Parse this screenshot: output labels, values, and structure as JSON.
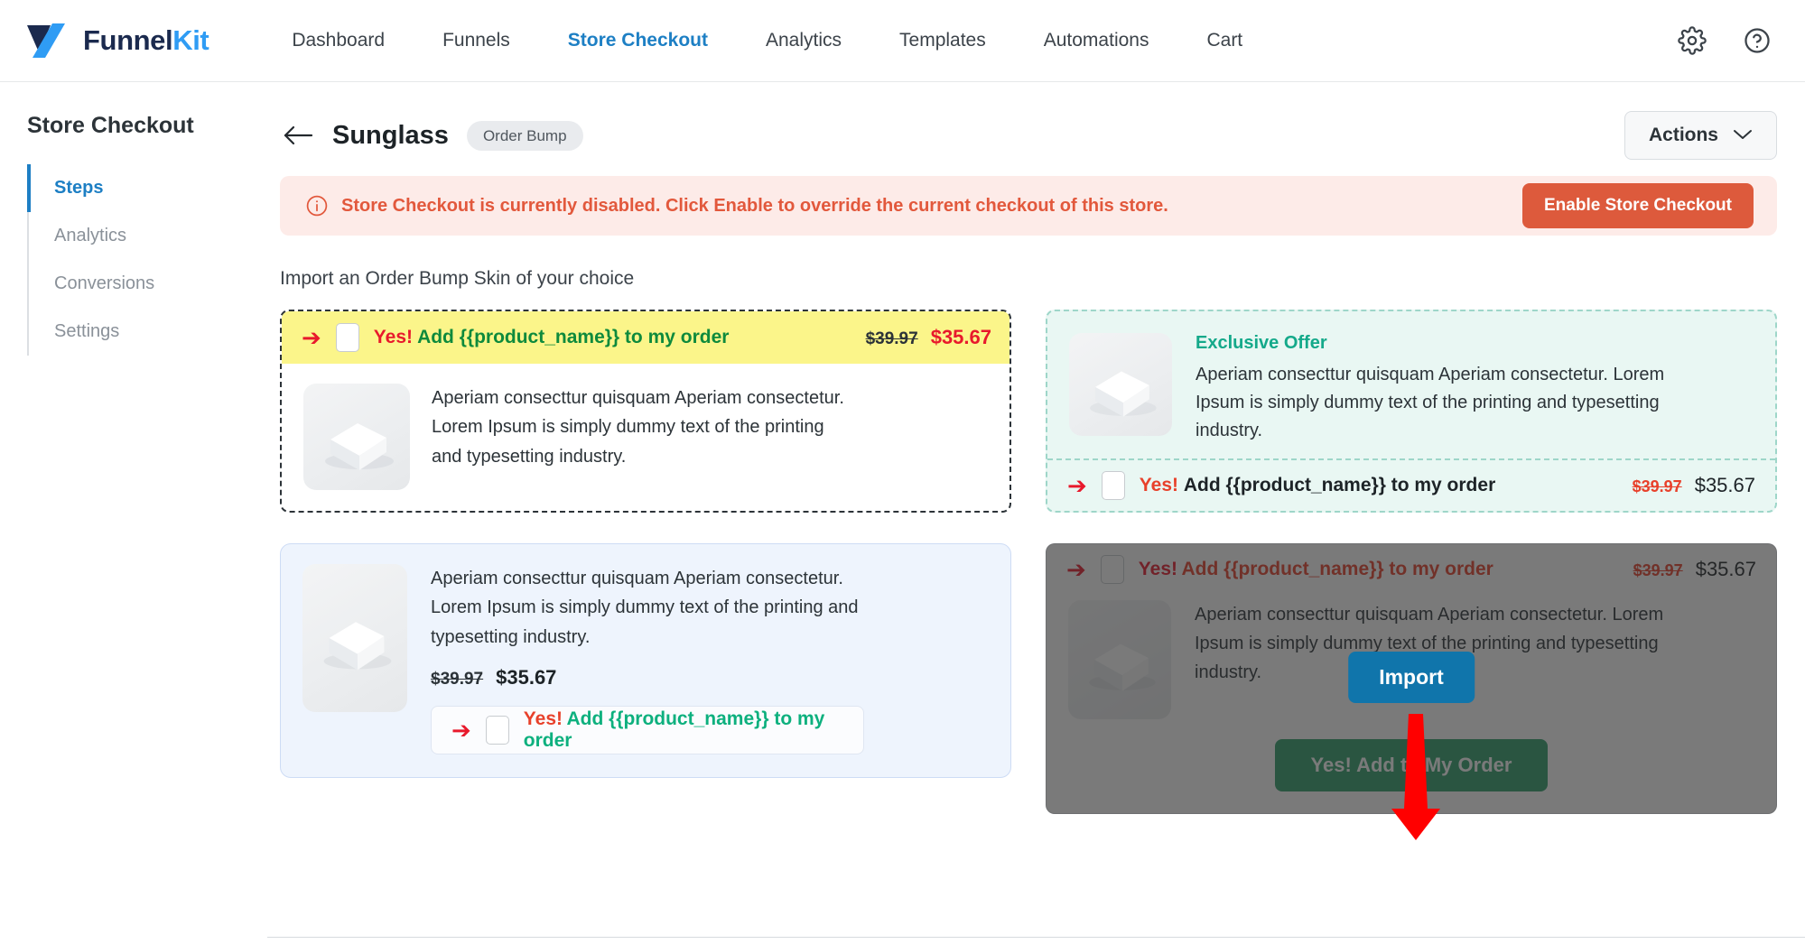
{
  "topnav": {
    "logo": {
      "part1": "Funnel",
      "part2": "Kit",
      "icon": "funnelkit-logo-icon"
    },
    "items": [
      {
        "label": "Dashboard",
        "active": false
      },
      {
        "label": "Funnels",
        "active": false
      },
      {
        "label": "Store Checkout",
        "active": true
      },
      {
        "label": "Analytics",
        "active": false
      },
      {
        "label": "Templates",
        "active": false
      },
      {
        "label": "Automations",
        "active": false
      },
      {
        "label": "Cart",
        "active": false
      }
    ],
    "settings_icon": "gear-icon",
    "help_icon": "help-circle-icon"
  },
  "sidebar": {
    "title": "Store Checkout",
    "items": [
      {
        "label": "Steps",
        "active": true
      },
      {
        "label": "Analytics",
        "active": false
      },
      {
        "label": "Conversions",
        "active": false
      },
      {
        "label": "Settings",
        "active": false
      }
    ]
  },
  "page": {
    "back_icon": "back-arrow-icon",
    "title": "Sunglass",
    "badge": "Order Bump",
    "actions_label": "Actions",
    "actions_chevron": "chevron-down-icon"
  },
  "alert": {
    "icon": "info-circle-icon",
    "message": "Store Checkout is currently disabled. Click Enable to override the current checkout of this store.",
    "button_label": "Enable Store Checkout",
    "bg_color": "#fdebe8",
    "text_color": "#e2583c",
    "button_color": "#dd5a3c"
  },
  "section": {
    "label": "Import an Order Bump Skin of your choice"
  },
  "shared": {
    "description": "Aperiam consecttur quisquam Aperiam consectetur. Lorem Ipsum is simply dummy text of the printing and typesetting industry.",
    "arrow_icon": "right-arrow-icon",
    "checkbox_icon": "checkbox-unchecked",
    "product_image_icon": "product-box-image"
  },
  "skins": [
    {
      "name": "yellow-bar-skin",
      "yes_label": "Yes!",
      "offer_label": "Add {{product_name}} to my order",
      "old_price": "$39.97",
      "new_price": "$35.67",
      "description": "Aperiam consecttur quisquam Aperiam consectetur. Lorem Ipsum is simply dummy text of the printing and typesetting industry.",
      "bar_bg": "#fbf58a",
      "border": "#2c3338"
    },
    {
      "name": "mint-exclusive-skin",
      "heading": "Exclusive Offer",
      "yes_label": "Yes!",
      "offer_label": "Add {{product_name}} to my order",
      "old_price": "$39.97",
      "new_price": "$35.67",
      "description": "Aperiam consecttur quisquam Aperiam consectetur. Lorem Ipsum is simply dummy text of the printing and typesetting industry.",
      "bg": "#e9f7f3",
      "accent": "#14a98a"
    },
    {
      "name": "blue-card-skin",
      "yes_label": "Yes!",
      "offer_label": "Add {{product_name}} to my order",
      "old_price": "$39.97",
      "new_price": "$35.67",
      "description": "Aperiam consecttur quisquam Aperiam consectetur. Lorem Ipsum is simply dummy text of the printing and typesetting industry.",
      "bg": "#eef4fd",
      "accent": "#0db07e"
    },
    {
      "name": "green-cta-skin",
      "yes_label": "Yes!",
      "offer_label": "Add {{product_name}} to my order",
      "old_price": "$39.97",
      "new_price": "$35.67",
      "description": "Aperiam consecttur quisquam Aperiam consectetur. Lorem Ipsum is simply dummy text of the printing and typesetting industry.",
      "cta_label": "Yes! Add to My Order",
      "hovered": true,
      "import_label": "Import",
      "import_color": "#1075ab"
    }
  ],
  "annotation": {
    "arrow_color": "#ff0000",
    "points_to": "Import"
  }
}
